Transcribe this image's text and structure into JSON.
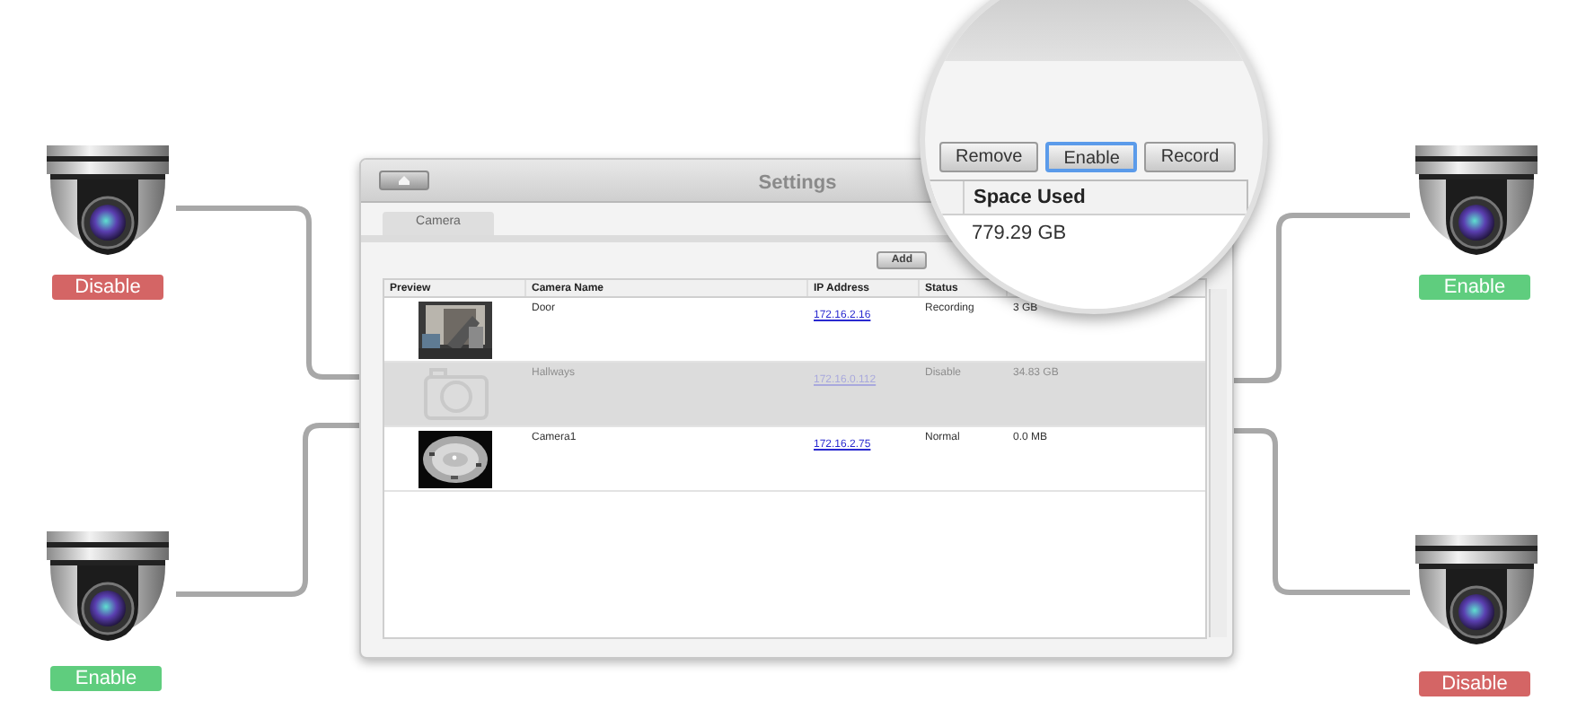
{
  "cameras": [
    {
      "badge": "Disable",
      "color": "#d46565"
    },
    {
      "badge": "Enable",
      "color": "#5fcd7e"
    },
    {
      "badge": "Enable",
      "color": "#5fcd7e"
    },
    {
      "badge": "Disable",
      "color": "#d46565"
    }
  ],
  "window": {
    "title": "Settings",
    "tabs": [
      {
        "label": "Camera",
        "selected": true
      }
    ],
    "toolbar": [
      "Add"
    ],
    "table": {
      "columns": [
        "Preview",
        "Camera Name",
        "IP Address",
        "Status"
      ],
      "rows": [
        {
          "kind": "picture",
          "name": "Door",
          "ip": "172.16.2.16",
          "status": "Recording",
          "space": "3 GB",
          "disabled": false
        },
        {
          "kind": "placeholder",
          "name": "Hallways",
          "ip": "172.16.0.112",
          "status": "Disable",
          "space": "34.83 GB",
          "disabled": true
        },
        {
          "kind": "picture",
          "name": "Camera1",
          "ip": "172.16.2.75",
          "status": "Normal",
          "space": "0.0 MB",
          "disabled": false
        }
      ]
    }
  },
  "magnifier": {
    "buttons": [
      {
        "label": "Remove",
        "focused": false
      },
      {
        "label": "Enable",
        "focused": true
      },
      {
        "label": "Record",
        "focused": false
      }
    ],
    "column": "Space Used",
    "cell": "779.29 GB"
  }
}
